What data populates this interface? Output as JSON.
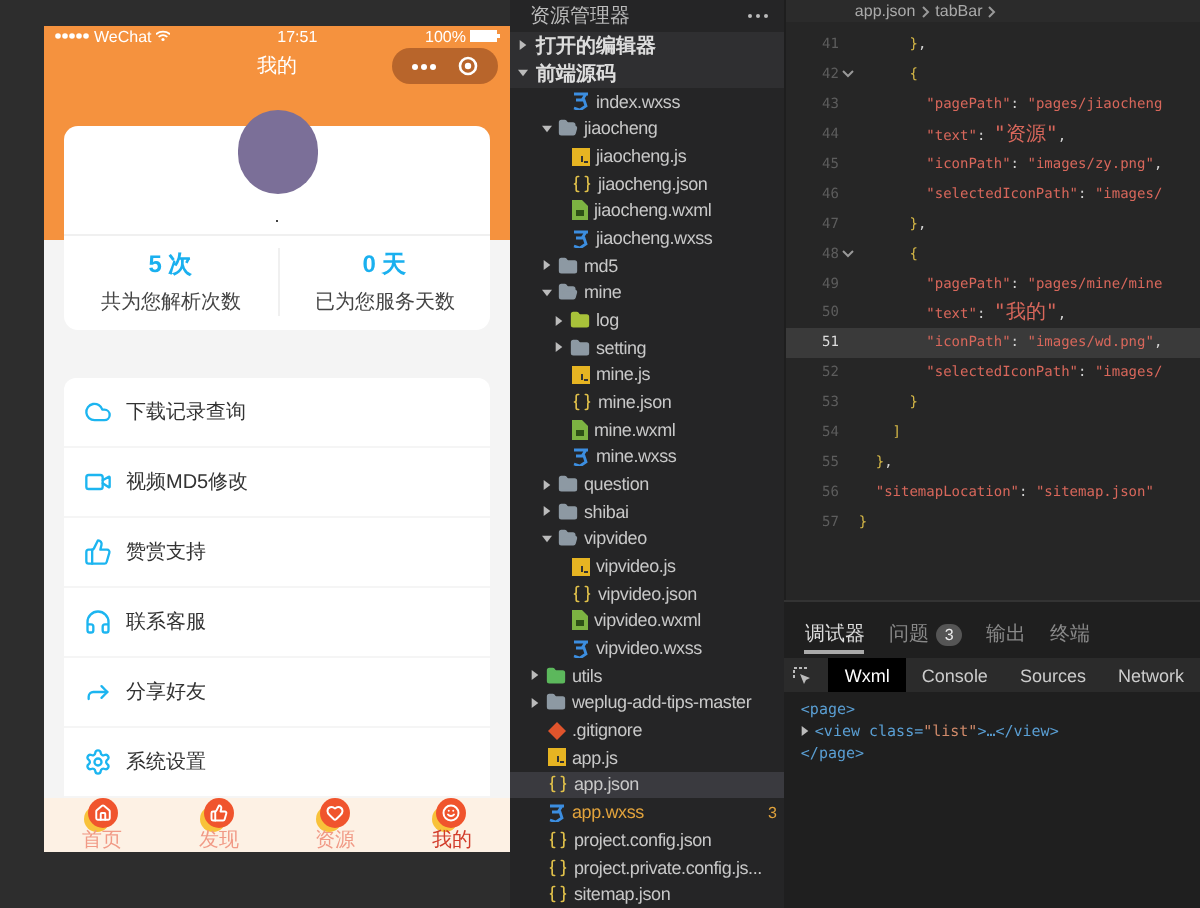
{
  "simulator": {
    "status_bar": {
      "carrier": "WeChat",
      "time": "17:51",
      "battery": "100%"
    },
    "nav_title": "我的",
    "profile": {
      "nickname": "."
    },
    "stats": [
      {
        "value": "5 次",
        "label": "共为您解析次数"
      },
      {
        "value": "0 天",
        "label": "已为您服务天数"
      }
    ],
    "menu": [
      {
        "kind": "cloud",
        "label": "下载记录查询"
      },
      {
        "kind": "video",
        "label": "视频MD5修改"
      },
      {
        "kind": "thumb",
        "label": "赞赏支持"
      },
      {
        "kind": "service",
        "label": "联系客服"
      },
      {
        "kind": "share",
        "label": "分享好友"
      },
      {
        "kind": "settings",
        "label": "系统设置"
      }
    ],
    "tab_bar": [
      {
        "kind": "home",
        "label": "首页",
        "selected": false
      },
      {
        "kind": "thumb",
        "label": "发现",
        "selected": false
      },
      {
        "kind": "heart",
        "label": "资源",
        "selected": false
      },
      {
        "kind": "smile",
        "label": "我的",
        "selected": true
      }
    ]
  },
  "explorer": {
    "title": "资源管理器",
    "sections": [
      {
        "label": "打开的编辑器",
        "expanded": false
      },
      {
        "label": "前端源码",
        "expanded": true,
        "tree": [
          {
            "children": [
              {
                "children": [
                  {
                    "kind": "wxss",
                    "name": "index.wxss",
                    "selected": false
                  }
                ]
              },
              {
                "kind": "folder",
                "name": "jiaocheng",
                "color": "#8d99a3",
                "expanded": true,
                "selected": false,
                "children": [
                  {
                    "kind": "js",
                    "name": "jiaocheng.js",
                    "selected": false
                  },
                  {
                    "kind": "json",
                    "name": "jiaocheng.json",
                    "selected": false
                  },
                  {
                    "kind": "wxml",
                    "name": "jiaocheng.wxml",
                    "selected": false
                  },
                  {
                    "kind": "wxss",
                    "name": "jiaocheng.wxss",
                    "selected": false
                  }
                ]
              },
              {
                "kind": "folder",
                "name": "md5",
                "color": "#8d99a3",
                "expanded": false,
                "selected": false
              },
              {
                "kind": "folder",
                "name": "mine",
                "color": "#8d99a3",
                "expanded": true,
                "selected": false,
                "children": [
                  {
                    "kind": "folder",
                    "name": "log",
                    "color": "#a8c23a",
                    "expanded": false,
                    "selected": false
                  },
                  {
                    "kind": "folder",
                    "name": "setting",
                    "color": "#8d99a3",
                    "expanded": false,
                    "selected": false
                  },
                  {
                    "kind": "js",
                    "name": "mine.js",
                    "selected": false
                  },
                  {
                    "kind": "json",
                    "name": "mine.json",
                    "selected": false
                  },
                  {
                    "kind": "wxml",
                    "name": "mine.wxml",
                    "selected": false
                  },
                  {
                    "kind": "wxss",
                    "name": "mine.wxss",
                    "selected": false
                  }
                ]
              },
              {
                "kind": "folder",
                "name": "question",
                "color": "#8d99a3",
                "expanded": false,
                "selected": false
              },
              {
                "kind": "folder",
                "name": "shibai",
                "color": "#8d99a3",
                "expanded": false,
                "selected": false
              },
              {
                "kind": "folder",
                "name": "vipvideo",
                "color": "#8d99a3",
                "expanded": true,
                "selected": false,
                "children": [
                  {
                    "kind": "js",
                    "name": "vipvideo.js",
                    "selected": false
                  },
                  {
                    "kind": "json",
                    "name": "vipvideo.json",
                    "selected": false
                  },
                  {
                    "kind": "wxml",
                    "name": "vipvideo.wxml",
                    "selected": false
                  },
                  {
                    "kind": "wxss",
                    "name": "vipvideo.wxss",
                    "selected": false
                  }
                ]
              }
            ]
          },
          {
            "kind": "folder",
            "name": "utils",
            "color": "#5cb85c",
            "expanded": false,
            "selected": false
          },
          {
            "kind": "folder",
            "name": "weplug-add-tips-master",
            "color": "#8d99a3",
            "expanded": false,
            "selected": false
          },
          {
            "kind": "git",
            "name": ".gitignore",
            "selected": false
          },
          {
            "kind": "js",
            "name": "app.js",
            "selected": false
          },
          {
            "kind": "json",
            "name": "app.json",
            "selected": true
          },
          {
            "kind": "wxss",
            "name": "app.wxss",
            "selected": false,
            "warning": true,
            "badge": "3"
          },
          {
            "kind": "json",
            "name": "project.config.json",
            "selected": false
          },
          {
            "kind": "json",
            "name": "project.private.config.js...",
            "selected": false
          },
          {
            "kind": "json",
            "name": "sitemap.json",
            "selected": false
          }
        ]
      }
    ]
  },
  "editor": {
    "breadcrumb": [
      "app.json",
      "tabBar"
    ],
    "lines": [
      {
        "number": "41",
        "code": "      },"
      },
      {
        "number": "42",
        "code": "      {",
        "foldable": true
      },
      {
        "number": "43",
        "code": "        \"pagePath\": \"pages/jiaocheng"
      },
      {
        "number": "44",
        "code": "        \"text\": \"资源\","
      },
      {
        "number": "45",
        "code": "        \"iconPath\": \"images/zy.png\","
      },
      {
        "number": "46",
        "code": "        \"selectedIconPath\": \"images/"
      },
      {
        "number": "47",
        "code": "      },"
      },
      {
        "number": "48",
        "code": "      {",
        "foldable": true
      },
      {
        "number": "49",
        "code": "        \"pagePath\": \"pages/mine/mine"
      },
      {
        "number": "50",
        "code": "        \"text\": \"我的\","
      },
      {
        "number": "51",
        "code": "        \"iconPath\": \"images/wd.png\",",
        "current": true
      },
      {
        "number": "52",
        "code": "        \"selectedIconPath\": \"images/"
      },
      {
        "number": "53",
        "code": "      }"
      },
      {
        "number": "54",
        "code": "    ]"
      },
      {
        "number": "55",
        "code": "  },"
      },
      {
        "number": "56",
        "code": "  \"sitemapLocation\": \"sitemap.json\""
      },
      {
        "number": "57",
        "code": "}"
      }
    ]
  },
  "devtools": {
    "tabs": [
      {
        "label": "调试器",
        "selected": true
      },
      {
        "label": "问题",
        "badge": "3",
        "selected": false
      },
      {
        "label": "输出",
        "selected": false
      },
      {
        "label": "终端",
        "selected": false
      }
    ],
    "panel_tabs": [
      {
        "label": "Wxml",
        "selected": true
      },
      {
        "label": "Console",
        "selected": false
      },
      {
        "label": "Sources",
        "selected": false
      },
      {
        "label": "Network",
        "selected": false
      }
    ],
    "dom": [
      {
        "code": "<page>"
      },
      {
        "code": "<view class=\"list\">…</view>",
        "expanded": false
      },
      {
        "code": "</page>"
      }
    ]
  }
}
